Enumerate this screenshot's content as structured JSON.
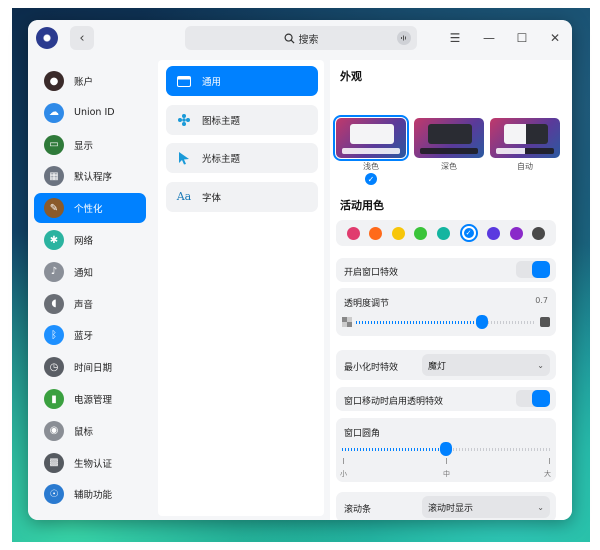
{
  "titlebar": {
    "back_symbol": "‹",
    "search_placeholder": "搜索",
    "controls": [
      "☰",
      "—",
      "☐",
      "✕"
    ]
  },
  "sidebar": {
    "items": [
      {
        "label": "账户",
        "icon": "account-icon",
        "color": "#3a2a2a"
      },
      {
        "label": "Union ID",
        "icon": "cloud-icon",
        "color": "#2f8ae8"
      },
      {
        "label": "显示",
        "icon": "display-icon",
        "color": "#2f7a3a"
      },
      {
        "label": "默认程序",
        "icon": "default-apps-icon",
        "color": "#6b7380"
      },
      {
        "label": "个性化",
        "icon": "personalization-icon",
        "color": "#8a5a2a",
        "active": true
      },
      {
        "label": "网络",
        "icon": "network-icon",
        "color": "#2bb3a0"
      },
      {
        "label": "通知",
        "icon": "notification-icon",
        "color": "#8a8f98"
      },
      {
        "label": "声音",
        "icon": "sound-icon",
        "color": "#6a6e75"
      },
      {
        "label": "蓝牙",
        "icon": "bluetooth-icon",
        "color": "#1e90ff"
      },
      {
        "label": "时间日期",
        "icon": "clock-icon",
        "color": "#5a5e65"
      },
      {
        "label": "电源管理",
        "icon": "battery-icon",
        "color": "#3aa040"
      },
      {
        "label": "鼠标",
        "icon": "mouse-icon",
        "color": "#8a8e95"
      },
      {
        "label": "生物认证",
        "icon": "biometric-icon",
        "color": "#555a60"
      },
      {
        "label": "辅助功能",
        "icon": "accessibility-icon",
        "color": "#2a7ad0"
      }
    ]
  },
  "midpanel": {
    "items": [
      {
        "label": "通用",
        "icon": "window-icon",
        "active": true
      },
      {
        "label": "图标主题",
        "icon": "icon-theme-icon"
      },
      {
        "label": "光标主题",
        "icon": "cursor-icon"
      },
      {
        "label": "字体",
        "icon": "font-icon",
        "glyph": "Aa"
      }
    ]
  },
  "appearance": {
    "title": "外观",
    "themes": [
      {
        "label": "浅色",
        "selected": true
      },
      {
        "label": "深色"
      },
      {
        "label": "自动"
      }
    ]
  },
  "accent": {
    "title": "活动用色",
    "colors": [
      "#e03c6e",
      "#ff6a1a",
      "#f7c60a",
      "#3ac43a",
      "#14b5a0",
      "#0081ff",
      "#5a3adf",
      "#8a2ac9",
      "#4a4a4a"
    ],
    "selected_index": 5
  },
  "settings": {
    "window_effect": {
      "label": "开启窗口特效",
      "on": true
    },
    "transparency": {
      "label": "透明度调节",
      "value_text": "0.7",
      "value": 0.7
    },
    "minimize_effect": {
      "label": "最小化时特效",
      "value": "魔灯"
    },
    "move_transparent": {
      "label": "窗口移动时启用透明特效",
      "on": true
    },
    "corner": {
      "label": "窗口圆角",
      "ticks": [
        "小",
        "中",
        "大"
      ],
      "value": 0.5
    },
    "scrollbar": {
      "label": "滚动条",
      "value": "滚动时显示"
    }
  }
}
